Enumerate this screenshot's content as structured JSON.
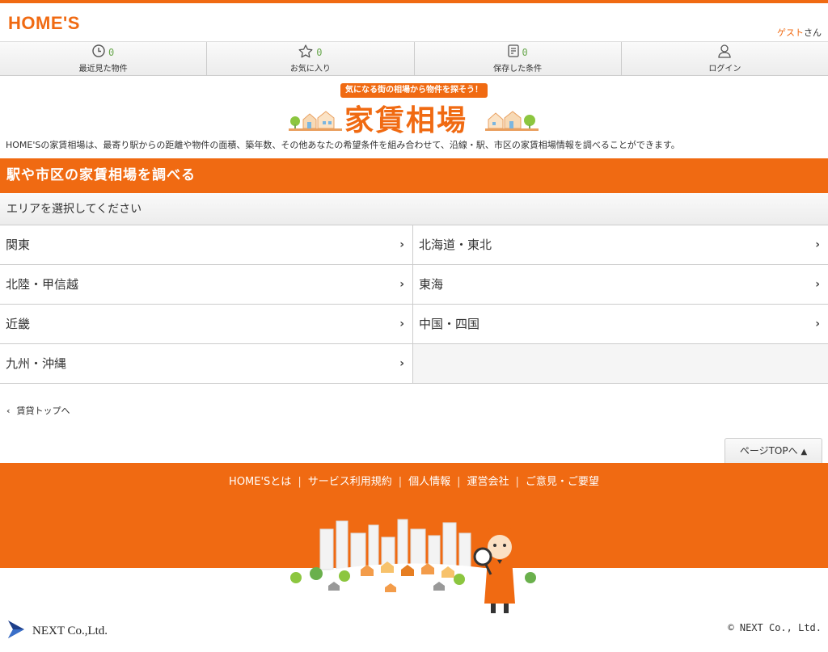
{
  "header": {
    "logo": "HOME'S",
    "guest_name": "ゲスト",
    "guest_suffix": "さん"
  },
  "nav": [
    {
      "icon": "clock-icon",
      "count": "0",
      "label": "最近見た物件"
    },
    {
      "icon": "star-icon",
      "count": "0",
      "label": "お気に入り"
    },
    {
      "icon": "memo-icon",
      "count": "0",
      "label": "保存した条件"
    },
    {
      "icon": "user-icon",
      "count": "",
      "label": "ログイン"
    }
  ],
  "banner": {
    "tagline": "気になる街の相場から物件を探そう！",
    "title": "家賃相場"
  },
  "intro": "HOME'Sの家賃相場は、最寄り駅からの距離や物件の面積、築年数、その他あなたの希望条件を組み合わせて、沿線・駅、市区の家賃相場情報を調べることができます。",
  "section": {
    "title": "駅や市区の家賃相場を調べる",
    "subtitle": "エリアを選択してください"
  },
  "areas": [
    "関東",
    "北海道・東北",
    "北陸・甲信越",
    "東海",
    "近畿",
    "中国・四国",
    "九州・沖縄"
  ],
  "back_link": "賃貸トップへ",
  "pagetop": "ページTOPへ",
  "footer": {
    "links": [
      "HOME'Sとは",
      "サービス利用規約",
      "個人情報",
      "運営会社",
      "ご意見・ご要望"
    ]
  },
  "company": "NEXT Co.,Ltd.",
  "copyright": "© NEXT Co., Ltd.",
  "colors": {
    "brand": "#f06a12",
    "count": "#6aa84f"
  }
}
